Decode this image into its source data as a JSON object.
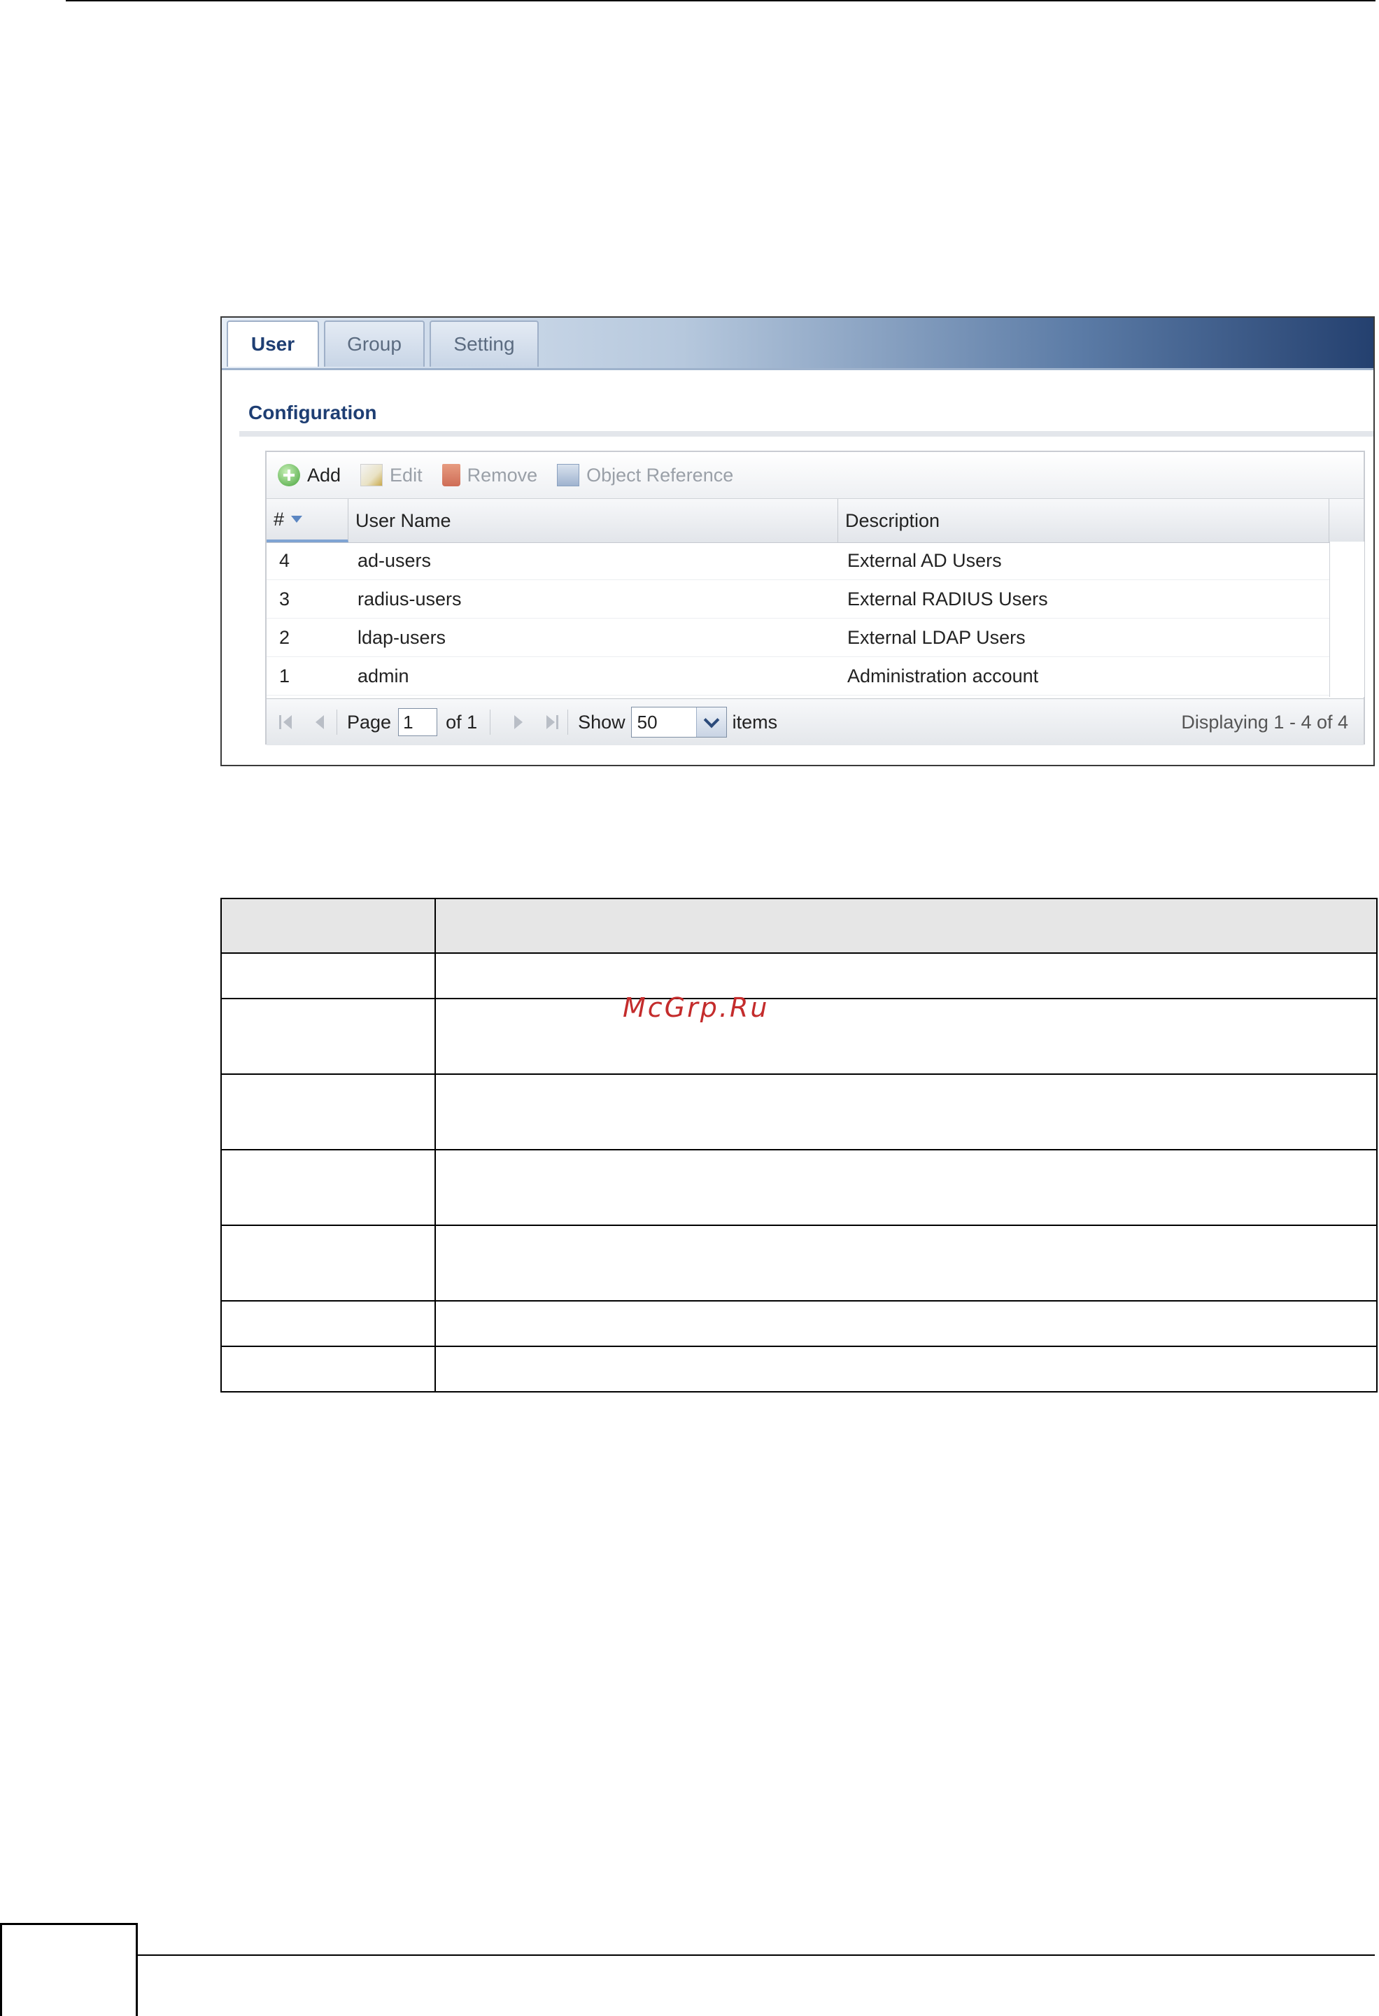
{
  "tabs": [
    {
      "label": "User",
      "active": true
    },
    {
      "label": "Group",
      "active": false
    },
    {
      "label": "Setting",
      "active": false
    }
  ],
  "section_title": "Configuration",
  "toolbar": {
    "add": "Add",
    "edit": "Edit",
    "remove": "Remove",
    "object_reference": "Object Reference"
  },
  "table": {
    "columns": [
      "#",
      "User Name",
      "Description"
    ],
    "rows": [
      {
        "num": "4",
        "user_name": "ad-users",
        "description": "External AD Users"
      },
      {
        "num": "3",
        "user_name": "radius-users",
        "description": "External RADIUS Users"
      },
      {
        "num": "2",
        "user_name": "ldap-users",
        "description": "External LDAP Users"
      },
      {
        "num": "1",
        "user_name": "admin",
        "description": "Administration account"
      }
    ]
  },
  "pager": {
    "page_label": "Page",
    "page_value": "1",
    "of_label": "of 1",
    "show_label": "Show",
    "show_value": "50",
    "items_label": "items",
    "display_info": "Displaying 1 - 4 of 4"
  },
  "watermark": "McGrp.Ru",
  "colors": {
    "tab_active_text": "#1e3e73",
    "section_title": "#1e3e73",
    "watermark": "#c42c2c"
  }
}
